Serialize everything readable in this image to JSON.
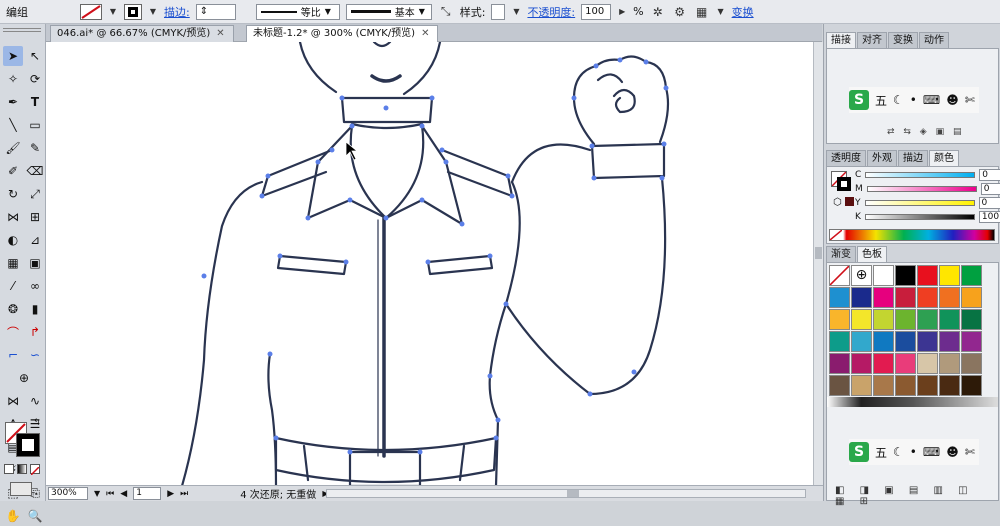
{
  "control_bar": {
    "mode_label": "编组",
    "stroke_link": "描边:",
    "uniform_label": "等比",
    "basic_label": "基本",
    "style_label": "样式:",
    "opacity_link": "不透明度:",
    "opacity_value": "100",
    "opacity_unit": "%",
    "transform_link": "变换"
  },
  "tabs": [
    {
      "label": "046.ai* @ 66.67% (CMYK/预览)",
      "active": false
    },
    {
      "label": "未标题-1.2* @ 300% (CMYK/预览)",
      "active": true
    }
  ],
  "status_bar": {
    "zoom": "300%",
    "page": "1",
    "message": "4 次还原; 无重做"
  },
  "panel_top": {
    "tabs": [
      "描接",
      "对齐",
      "变换",
      "动作"
    ],
    "ime_text": "五"
  },
  "panel_color": {
    "tabs": [
      "透明度",
      "外观",
      "描边",
      "颜色"
    ],
    "channels": [
      {
        "name": "C",
        "value": "0",
        "unit": "%"
      },
      {
        "name": "M",
        "value": "0",
        "unit": "%"
      },
      {
        "name": "Y",
        "value": "0",
        "unit": "%"
      },
      {
        "name": "K",
        "value": "100",
        "unit": "%"
      }
    ]
  },
  "panel_swatches": {
    "tabs": [
      "渐变",
      "色板"
    ],
    "ime_text": "五",
    "colors": [
      "#ffffff",
      "#000000",
      "#e8101e",
      "#ffe600",
      "#00a040",
      "#1e90d0",
      "#1a2a8c",
      "#e6007e",
      "#c81e3c",
      "#ef3e22",
      "#f07020",
      "#f7a21c",
      "#f9b52b",
      "#f3e62a",
      "#c3d530",
      "#6cb42e",
      "#2ea052",
      "#10935a",
      "#077343",
      "#0d9c8a",
      "#32a8cc",
      "#1079c1",
      "#1b4d9e",
      "#3c3592",
      "#6d2c8e",
      "#92278f",
      "#8a1c6e",
      "#b51a65",
      "#e21b50",
      "#e93c7a",
      "#d7c6a8",
      "#b09a7c",
      "#8a7560",
      "#6a5442",
      "#c9a36a",
      "#a8784a",
      "#8b5a30",
      "#6b3f1c",
      "#4a2a12",
      "#2d1a08"
    ]
  }
}
